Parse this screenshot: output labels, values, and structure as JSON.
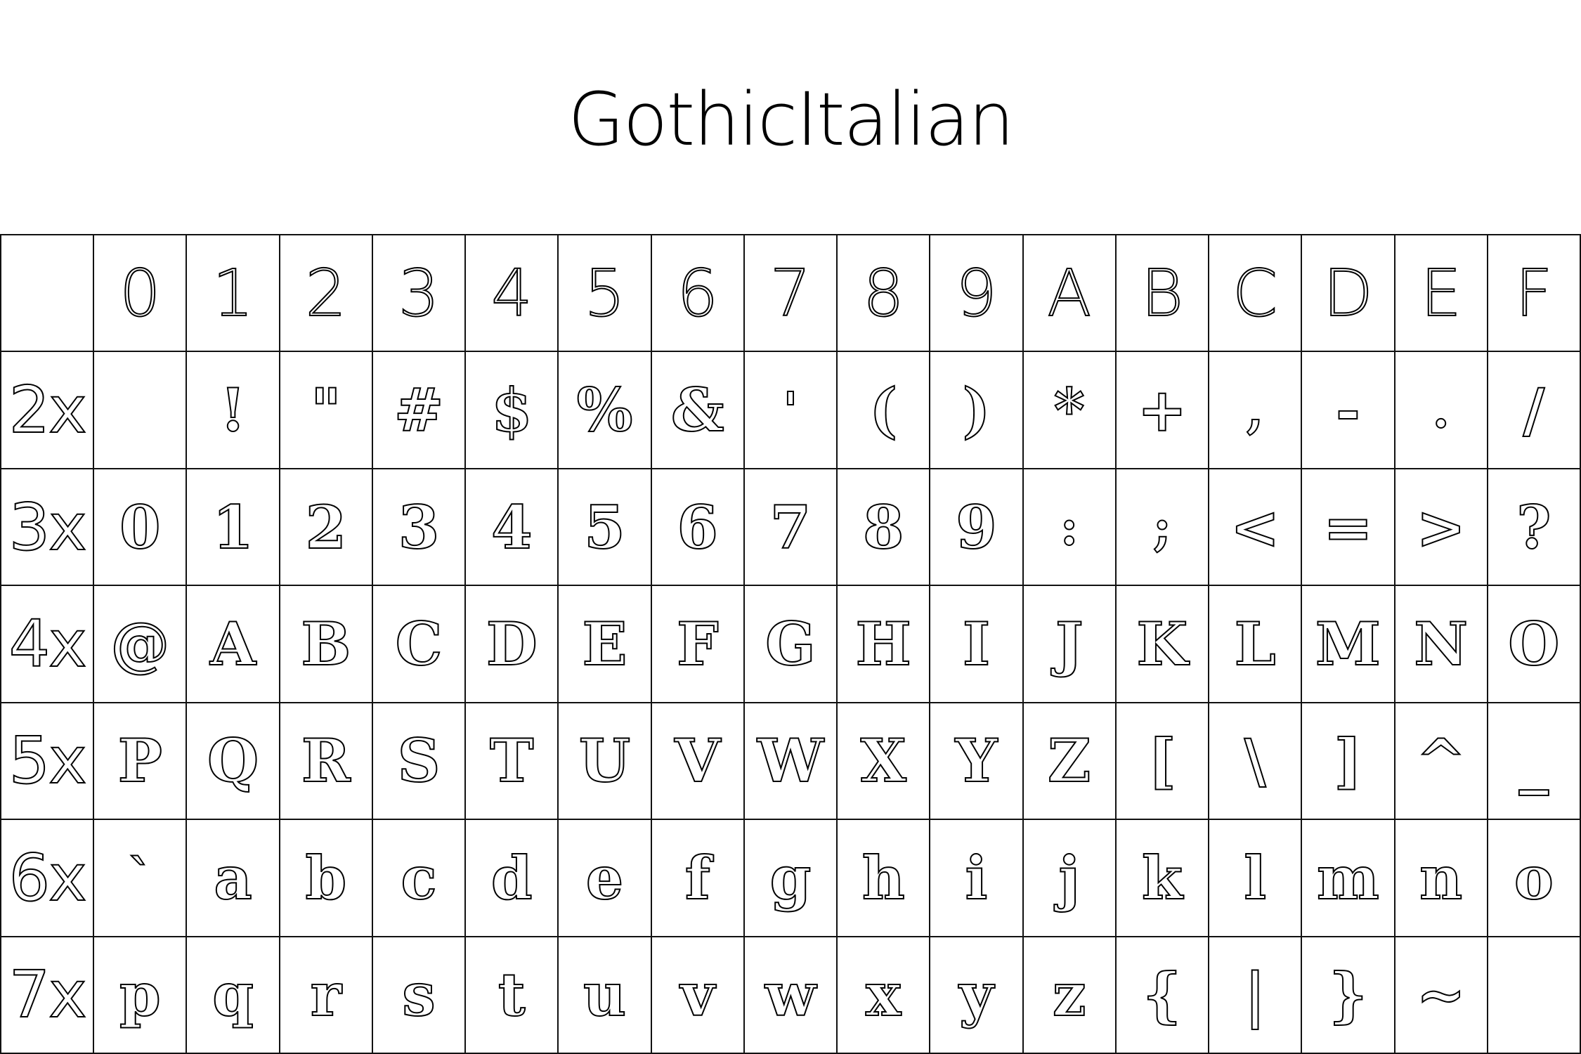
{
  "title": "GothicItalian",
  "column_headers": [
    "",
    "0",
    "1",
    "2",
    "3",
    "4",
    "5",
    "6",
    "7",
    "8",
    "9",
    "A",
    "B",
    "C",
    "D",
    "E",
    "F"
  ],
  "rows": [
    {
      "label": "2x",
      "cells": [
        " ",
        "!",
        "\"",
        "#",
        "$",
        "%",
        "&",
        "'",
        "(",
        ")",
        "*",
        "+",
        ",",
        "-",
        ".",
        "/"
      ]
    },
    {
      "label": "3x",
      "cells": [
        "0",
        "1",
        "2",
        "3",
        "4",
        "5",
        "6",
        "7",
        "8",
        "9",
        ":",
        ";",
        "<",
        "=",
        ">",
        "?"
      ]
    },
    {
      "label": "4x",
      "cells": [
        "@",
        "A",
        "B",
        "C",
        "D",
        "E",
        "F",
        "G",
        "H",
        "I",
        "J",
        "K",
        "L",
        "M",
        "N",
        "O"
      ]
    },
    {
      "label": "5x",
      "cells": [
        "P",
        "Q",
        "R",
        "S",
        "T",
        "U",
        "V",
        "W",
        "X",
        "Y",
        "Z",
        "[",
        "\\",
        "]",
        "^",
        "_"
      ]
    },
    {
      "label": "6x",
      "cells": [
        "`",
        "a",
        "b",
        "c",
        "d",
        "e",
        "f",
        "g",
        "h",
        "i",
        "j",
        "k",
        "l",
        "m",
        "n",
        "o"
      ]
    },
    {
      "label": "7x",
      "cells": [
        "p",
        "q",
        "r",
        "s",
        "t",
        "u",
        "v",
        "w",
        "x",
        "y",
        "z",
        "{",
        "|",
        "}",
        "~",
        ""
      ]
    }
  ]
}
